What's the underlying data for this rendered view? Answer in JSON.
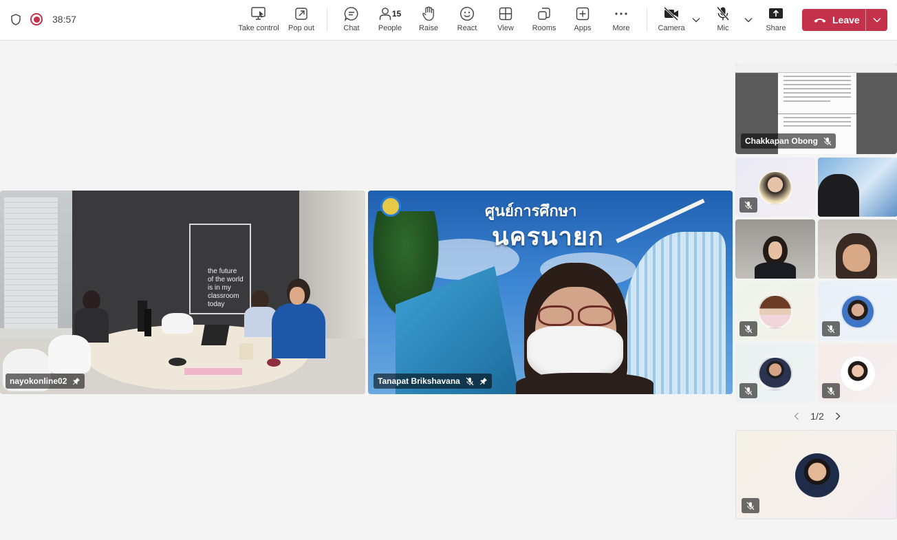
{
  "status": {
    "timer": "38:57"
  },
  "toolbar": {
    "take_control": "Take control",
    "pop_out": "Pop out",
    "chat": "Chat",
    "people": "People",
    "people_count": "15",
    "raise": "Raise",
    "react": "React",
    "view": "View",
    "rooms": "Rooms",
    "apps": "Apps",
    "more": "More",
    "camera": "Camera",
    "mic": "Mic",
    "share": "Share",
    "leave": "Leave"
  },
  "stage": {
    "room_tile": {
      "name": "nayokonline02",
      "board_text": "the future\nof the world\nis in my\nclassroom\ntoday"
    },
    "presenter_tile": {
      "name": "Tanapat Brikshavana",
      "background_line1": "ศูนย์การศึกษา",
      "background_line2": "นครนายก"
    }
  },
  "gallery": {
    "screen_share_name": "Chakkapan Obong",
    "page_indicator": "1/2"
  },
  "colors": {
    "leave": "#c4314b",
    "recording": "#c4314b",
    "topbar": "#ffffff",
    "stage_bg": "#f4f4f4"
  }
}
